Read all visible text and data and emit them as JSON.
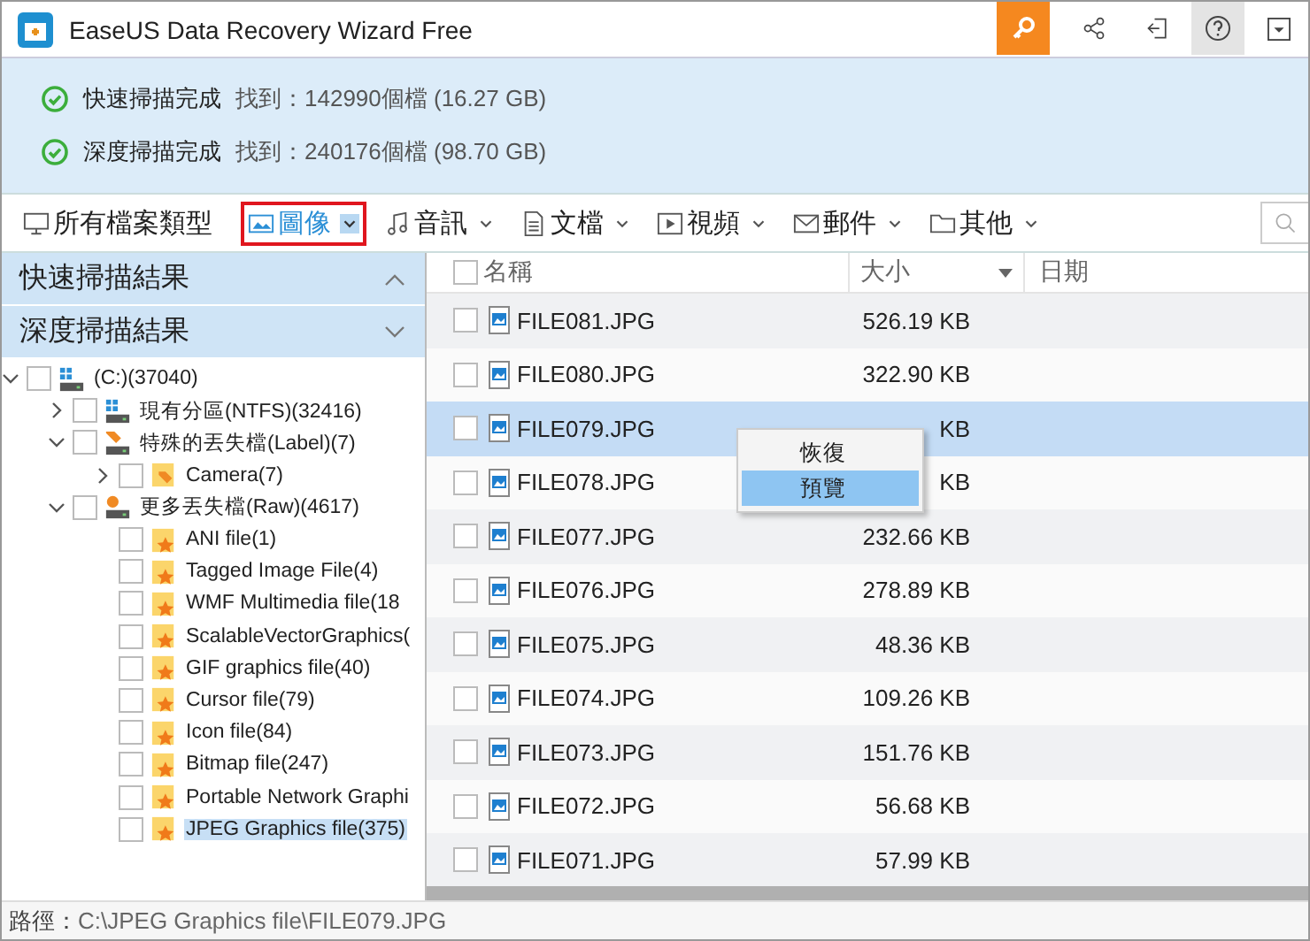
{
  "window": {
    "title": "EaseUS Data Recovery Wizard Free"
  },
  "scan_status": [
    {
      "label": "快速掃描完成",
      "result": "找到：142990個檔 (16.27 GB)"
    },
    {
      "label": "深度掃描完成",
      "result": "找到：240176個檔 (98.70 GB)"
    }
  ],
  "categories": [
    {
      "kind": "all",
      "label": "所有檔案類型",
      "selected": false
    },
    {
      "kind": "image",
      "label": "圖像",
      "selected": true
    },
    {
      "kind": "audio",
      "label": "音訊",
      "selected": false
    },
    {
      "kind": "document",
      "label": "文檔",
      "selected": false
    },
    {
      "kind": "video",
      "label": "視頻",
      "selected": false
    },
    {
      "kind": "mail",
      "label": "郵件",
      "selected": false
    },
    {
      "kind": "other",
      "label": "其他",
      "selected": false
    }
  ],
  "sidebar": {
    "sections": [
      {
        "label": "快速掃描結果",
        "expanded": true
      },
      {
        "label": "深度掃描結果",
        "expanded": false
      }
    ],
    "tree": [
      {
        "kind": "drive",
        "label": "(C:)(37040)",
        "checked": false,
        "expanded": true,
        "children": [
          {
            "kind": "partition",
            "label": "現有分區(NTFS)(32416)",
            "checked": false,
            "expanded": false
          },
          {
            "kind": "label-drive",
            "label": "特殊的丟失檔(Label)(7)",
            "checked": false,
            "expanded": true,
            "children": [
              {
                "kind": "tag-folder",
                "label": "Camera(7)",
                "checked": false,
                "expanded": false
              }
            ]
          },
          {
            "kind": "raw-drive",
            "label": "更多丟失檔(Raw)(4617)",
            "checked": false,
            "expanded": true,
            "children": [
              {
                "kind": "type-folder",
                "label": "ANI file(1)",
                "checked": false,
                "selected": false
              },
              {
                "kind": "type-folder",
                "label": "Tagged Image File(4)",
                "checked": false,
                "selected": false
              },
              {
                "kind": "type-folder",
                "label": "WMF Multimedia file(18",
                "checked": false,
                "selected": false
              },
              {
                "kind": "type-folder",
                "label": "ScalableVectorGraphics(",
                "checked": false,
                "selected": false
              },
              {
                "kind": "type-folder",
                "label": "GIF graphics file(40)",
                "checked": false,
                "selected": false
              },
              {
                "kind": "type-folder",
                "label": "Cursor file(79)",
                "checked": false,
                "selected": false
              },
              {
                "kind": "type-folder",
                "label": "Icon file(84)",
                "checked": false,
                "selected": false
              },
              {
                "kind": "type-folder",
                "label": "Bitmap file(247)",
                "checked": false,
                "selected": false
              },
              {
                "kind": "type-folder",
                "label": "Portable Network Graphi",
                "checked": false,
                "selected": false
              },
              {
                "kind": "type-folder",
                "label": "JPEG Graphics file(375)",
                "checked": false,
                "selected": true
              }
            ]
          }
        ]
      }
    ]
  },
  "table": {
    "columns": [
      "名稱",
      "大小",
      "日期"
    ],
    "select_all_checked": false,
    "rows": [
      {
        "name": "FILE081.JPG",
        "size": "526.19 KB",
        "checked": false,
        "selected": false
      },
      {
        "name": "FILE080.JPG",
        "size": "322.90 KB",
        "checked": false,
        "selected": false
      },
      {
        "name": "FILE079.JPG",
        "size": "KB",
        "checked": false,
        "selected": true
      },
      {
        "name": "FILE078.JPG",
        "size": "KB",
        "checked": false,
        "selected": false
      },
      {
        "name": "FILE077.JPG",
        "size": "232.66 KB",
        "checked": false,
        "selected": false
      },
      {
        "name": "FILE076.JPG",
        "size": "278.89 KB",
        "checked": false,
        "selected": false
      },
      {
        "name": "FILE075.JPG",
        "size": "48.36 KB",
        "checked": false,
        "selected": false
      },
      {
        "name": "FILE074.JPG",
        "size": "109.26 KB",
        "checked": false,
        "selected": false
      },
      {
        "name": "FILE073.JPG",
        "size": "151.76 KB",
        "checked": false,
        "selected": false
      },
      {
        "name": "FILE072.JPG",
        "size": "56.68 KB",
        "checked": false,
        "selected": false
      },
      {
        "name": "FILE071.JPG",
        "size": "57.99 KB",
        "checked": false,
        "selected": false
      }
    ]
  },
  "context_menu": [
    {
      "label": "恢復",
      "selected": false
    },
    {
      "label": "預覽",
      "selected": true
    }
  ],
  "status_bar": {
    "label": "路徑：",
    "path": "C:\\JPEG Graphics file\\FILE079.JPG"
  }
}
